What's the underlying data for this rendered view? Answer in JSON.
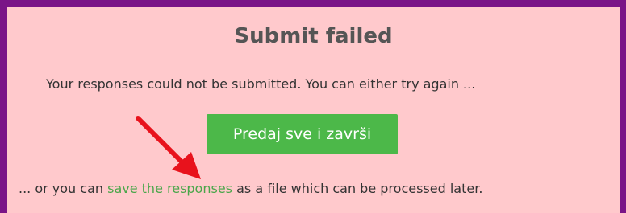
{
  "dialog": {
    "title": "Submit failed",
    "message": "Your responses could not be submitted. You can either try again ...",
    "submit_button_label": "Predaj sve i završi",
    "alt_prefix": "... or you can ",
    "alt_link_label": "save the responses",
    "alt_suffix": " as a file which can be processed later."
  },
  "colors": {
    "background": "#ffc9cc",
    "border": "#7a1487",
    "button": "#4cb849",
    "link": "#4aa64a",
    "annotation_arrow": "#e8121c"
  },
  "icons": {
    "annotation": "red-arrow-icon"
  }
}
